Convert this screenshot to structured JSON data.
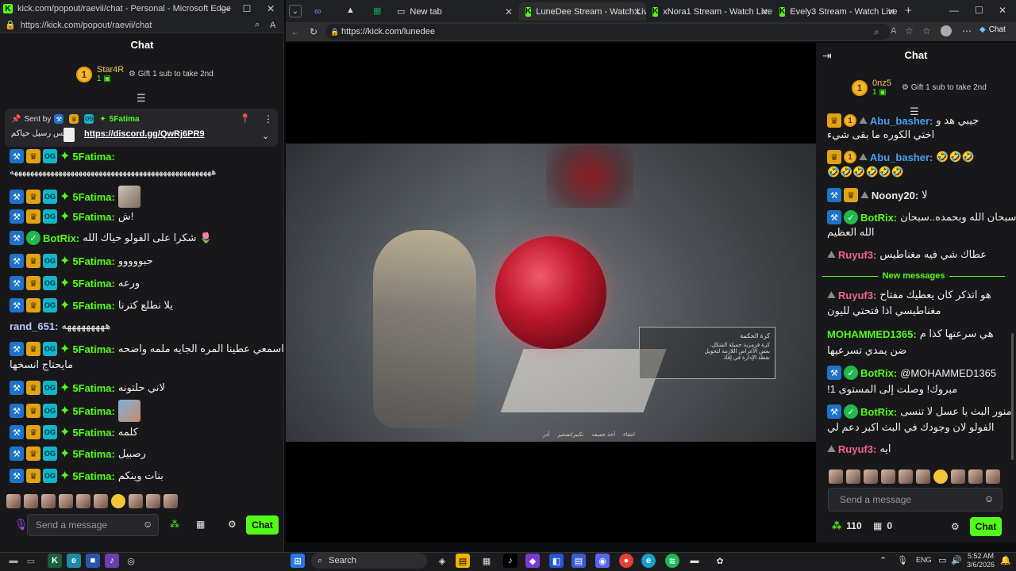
{
  "popup": {
    "title": "kick.com/popout/raevii/chat - Personal - Microsoft Edge",
    "url": "https://kick.com/popout/raevii/chat",
    "chat_title": "Chat",
    "leader": {
      "name": "Star4R",
      "count": "1",
      "rank": "1",
      "gift": "Gift 1 sub to take 2nd"
    },
    "pinned": {
      "sent_by": "Sent by",
      "user": "5Fatima",
      "text": "نس رسيل حياكم",
      "link": "https://discord.gg/QwRj6PR9"
    },
    "messages": [
      {
        "user": "5Fatima:",
        "text": "ههههههههههههههههههههههههههههههههههههههههههههههههههه"
      },
      {
        "user": "5Fatima:",
        "text": ""
      },
      {
        "user": "5Fatima:",
        "text": "ش!"
      },
      {
        "user": "BotRix:",
        "text": "شكرا على الفولو حياك الله 🌷"
      },
      {
        "user": "5Fatima:",
        "text": "حبووووو"
      },
      {
        "user": "5Fatima:",
        "text": "ورعه"
      },
      {
        "user": "5Fatima:",
        "text": "يلا نطلع كترنا"
      },
      {
        "user": "rand_651:",
        "text": "هههههههههه"
      },
      {
        "user": "5Fatima:",
        "text": "اسمعي عطينا المره الجايه ملمه واضحه"
      },
      {
        "user": "",
        "text": "مايحتاج انسخها"
      },
      {
        "user": "5Fatima:",
        "text": "لاني حلتونه"
      },
      {
        "user": "5Fatima:",
        "text": ""
      },
      {
        "user": "5Fatima:",
        "text": "كلمه"
      },
      {
        "user": "5Fatima:",
        "text": "رصبيل"
      },
      {
        "user": "5Fatima:",
        "text": "بنات وينكم"
      }
    ],
    "input_placeholder": "Send a message",
    "chat_button": "Chat"
  },
  "browser": {
    "tabs": [
      {
        "label": "New tab"
      },
      {
        "label": "LuneDee Stream - Watch Live on Kick"
      },
      {
        "label": "xNora1 Stream - Watch Live on Kick"
      },
      {
        "label": "Evely3 Stream - Watch Live on Kick"
      }
    ],
    "url": "https://kick.com/lunedee"
  },
  "game_hud": {
    "panel_title": "كرة الحكمة",
    "panel_lines": [
      "كرة قرمزية جميلة الشكل،",
      "بعض الأغراض اللازمة لتحويل",
      "نقطة الإدارة في إقاذ"
    ],
    "bottom_hints": [
      "انتقاء",
      "أخذ جميعه",
      "تكبير/تصغير",
      "أدر"
    ]
  },
  "right_chat": {
    "title": "Chat",
    "leader": {
      "name": "0nz5",
      "count": "1",
      "rank": "1",
      "gift": "Gift 1 sub to take 2nd"
    },
    "messages": [
      {
        "user": "Abu_basher:",
        "text": "جيبي هد و"
      },
      {
        "user": "",
        "text": "اختي الكوره ما بقى شيء"
      },
      {
        "user": "Abu_basher:",
        "text": "🤣🤣🤣"
      },
      {
        "user": "",
        "text": "🤣🤣🤣🤣🤣🤣"
      },
      {
        "user": "Noony20:",
        "text": "لا"
      },
      {
        "user": "BotRix:",
        "text": "سبحان الله وبحمده..سبحان"
      },
      {
        "user": "",
        "text": "الله العظيم"
      },
      {
        "user": "Ruyuf3:",
        "text": "عطاك شي فيه مغناطيس"
      },
      {
        "user": "Ruyuf3:",
        "text": "هو اتذكر كان يعطيك مفتاح"
      },
      {
        "user": "",
        "text": "مغناطيسي اذا فتحتي لليون"
      },
      {
        "user": "MOHAMMED1365:",
        "text": "هي سرعتها كذا م"
      },
      {
        "user": "",
        "text": "ضن يمدي تسرعيها"
      },
      {
        "user": "BotRix:",
        "text": "@MOHAMMED1365"
      },
      {
        "user": "",
        "text": "!مبروك! وصلت إلى المستوى 1"
      },
      {
        "user": "BotRix:",
        "text": "منور البث يا عسل لا تنسى"
      },
      {
        "user": "",
        "text": "الفولو لان وجودك في البث اكبر دعم لي"
      },
      {
        "user": "Ruyuf3:",
        "text": "ايه"
      }
    ],
    "new_messages": "New messages",
    "input_placeholder": "Send a message",
    "viewers": "110",
    "gifts": "0",
    "chat_button": "Chat"
  },
  "taskbar": {
    "search": "Search",
    "lang": "ENG",
    "time": "5:52 AM",
    "date": "3/6/2026"
  }
}
